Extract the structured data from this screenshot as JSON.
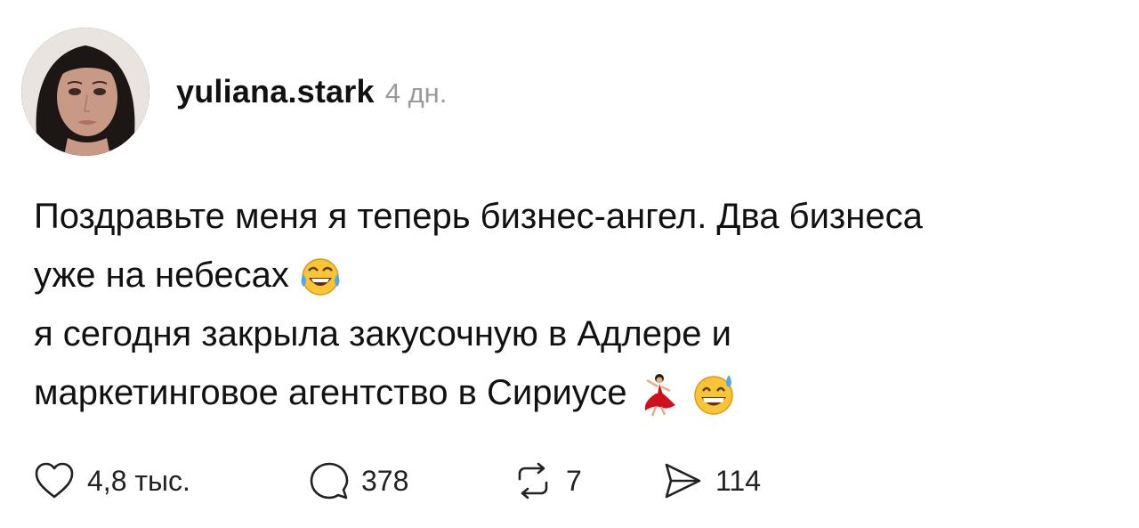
{
  "post": {
    "author": {
      "username": "yuliana.stark",
      "posted_ago": "4 дн."
    },
    "text": {
      "line1": "Поздравьте меня я теперь бизнес-ангел. Два бизнеса",
      "line2": "уже на небесах",
      "line3": "я сегодня закрыла закусочную в Адлере и",
      "line4": "маркетинговое агентство в Сириусе"
    },
    "emojis": {
      "line2": [
        "face-with-tears-of-joy"
      ],
      "line4": [
        "woman-dancing",
        "grinning-face-with-sweat"
      ]
    },
    "actions": {
      "likes": "4,8 тыс.",
      "comments": "378",
      "reposts": "7",
      "shares": "114"
    }
  },
  "colors": {
    "text": "#111111",
    "muted": "#9a9a9a",
    "background": "#ffffff"
  }
}
